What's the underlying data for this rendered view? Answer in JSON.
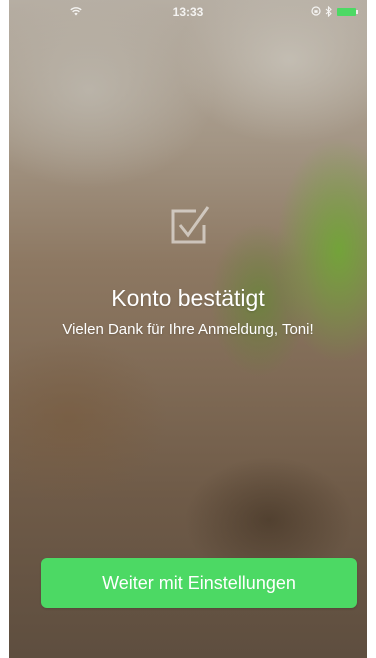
{
  "status_bar": {
    "time": "13:33",
    "wifi_icon": "wifi-icon",
    "rotation_lock_icon": "lock-rotation-icon",
    "bluetooth_icon": "bluetooth-icon",
    "battery_icon": "battery-icon",
    "battery_color": "#4cd964"
  },
  "confirmation": {
    "icon": "checkbox-checked-icon",
    "title": "Konto bestätigt",
    "message": "Vielen Dank für Ihre Anmeldung, Toni!"
  },
  "actions": {
    "continue_label": "Weiter mit Einstellungen",
    "button_color": "#4cd964"
  }
}
